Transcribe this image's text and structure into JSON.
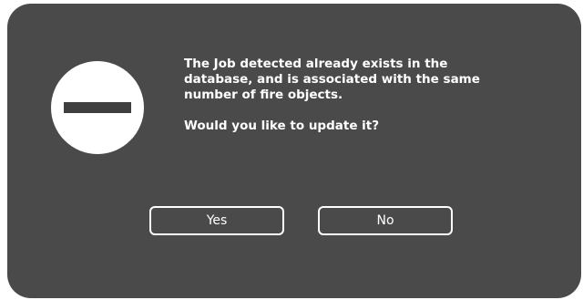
{
  "dialog": {
    "icon": "stop-icon",
    "message": "The Job detected already exists in the\ndatabase, and is associated with the same\nnumber of fire objects.",
    "question": "Would you like to update it?",
    "buttons": {
      "yes_label": "Yes",
      "no_label": "No"
    }
  },
  "colors": {
    "dialog_background": "#4a4a4a",
    "text": "#ffffff",
    "icon_circle": "#ffffff",
    "icon_bar": "#3f3f3f"
  }
}
